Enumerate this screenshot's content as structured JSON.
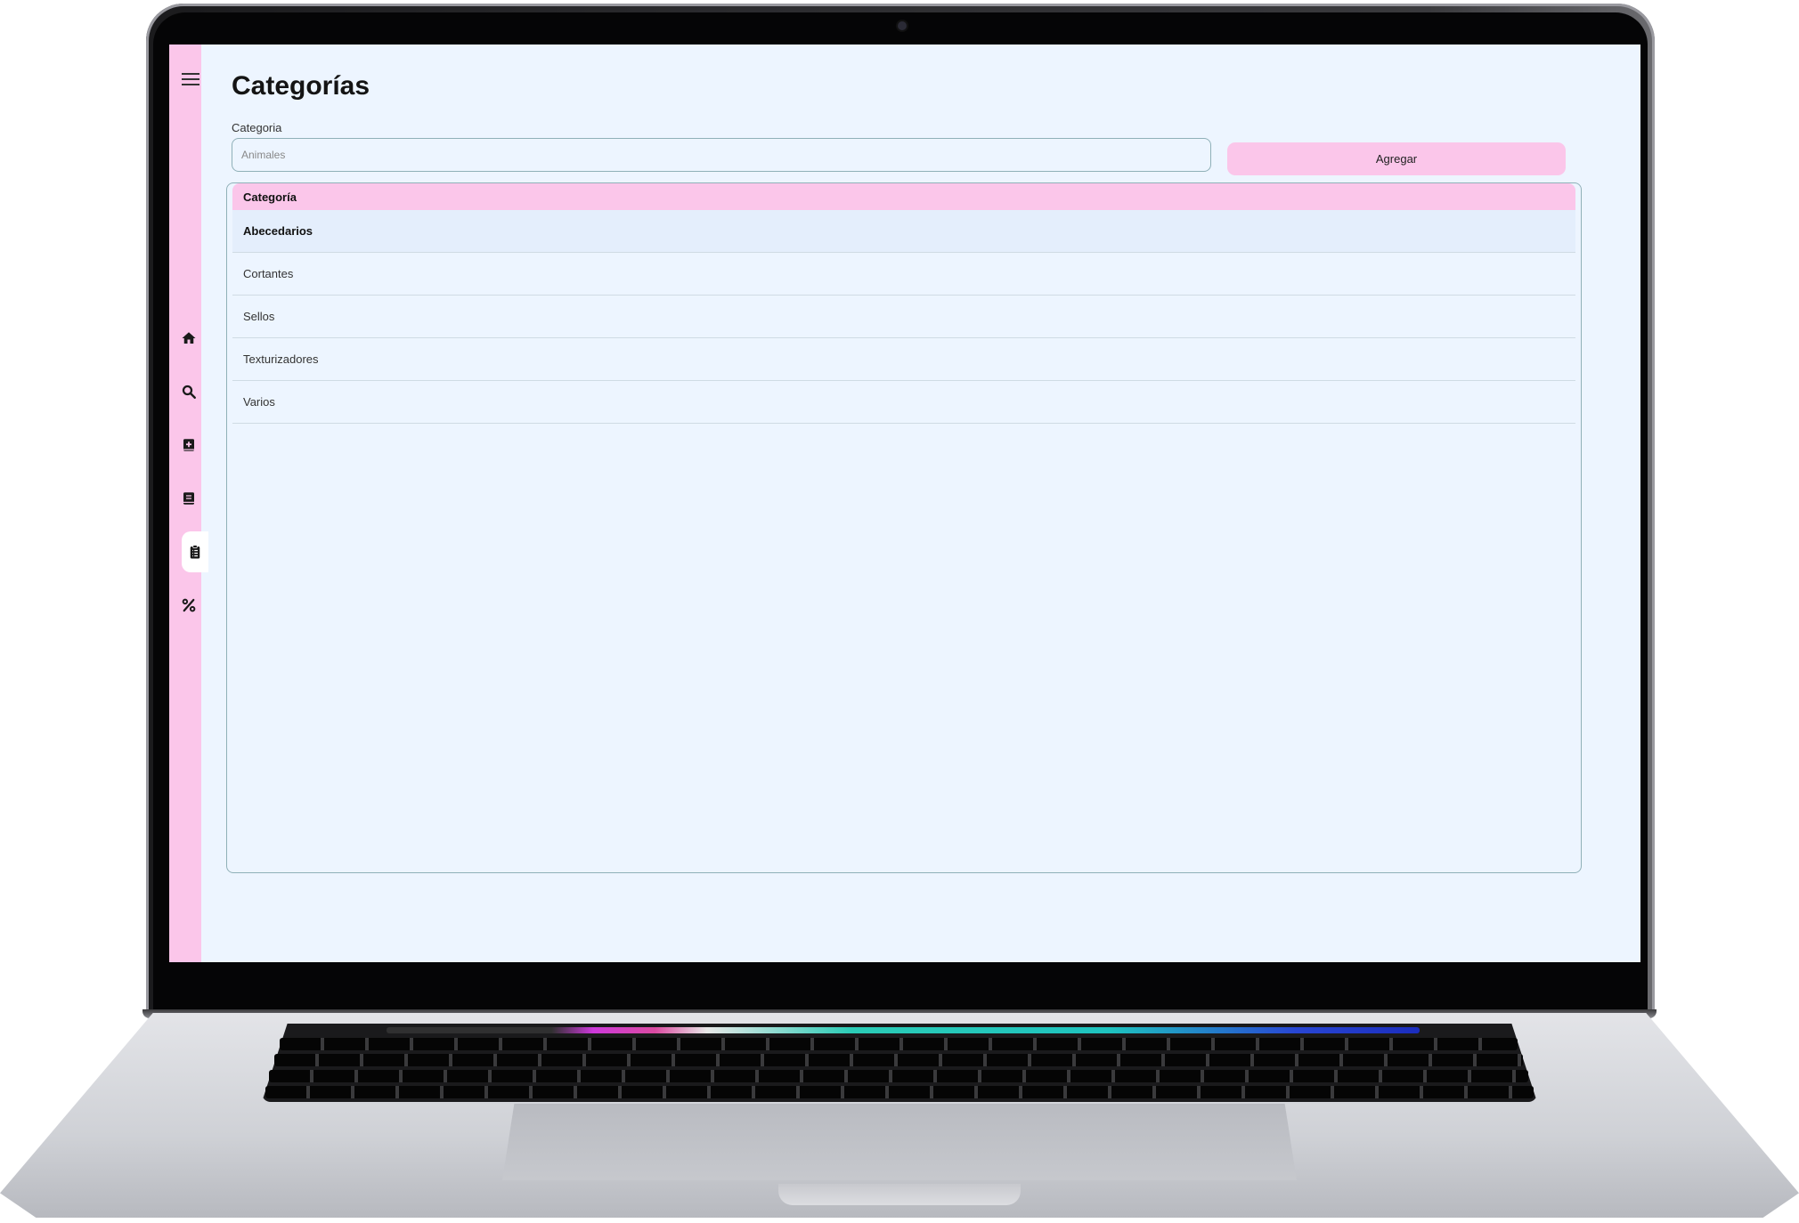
{
  "app": {
    "title": "Categorías"
  },
  "sidebar": {
    "items": [
      {
        "icon": "home-icon"
      },
      {
        "icon": "search-icon"
      },
      {
        "icon": "add-book-icon"
      },
      {
        "icon": "book-icon"
      },
      {
        "icon": "clipboard-list-icon",
        "active": true
      },
      {
        "icon": "percent-icon"
      }
    ]
  },
  "form": {
    "label": "Categoria",
    "input_placeholder": "Animales",
    "add_label": "Agregar"
  },
  "table": {
    "header": "Categoría",
    "rows": [
      "Abecedarios",
      "Cortantes",
      "Sellos",
      "Texturizadores",
      "Varios"
    ]
  },
  "colors": {
    "accent": "#fbc6ea",
    "background": "#edf5ff",
    "border": "#8fb0b8"
  }
}
